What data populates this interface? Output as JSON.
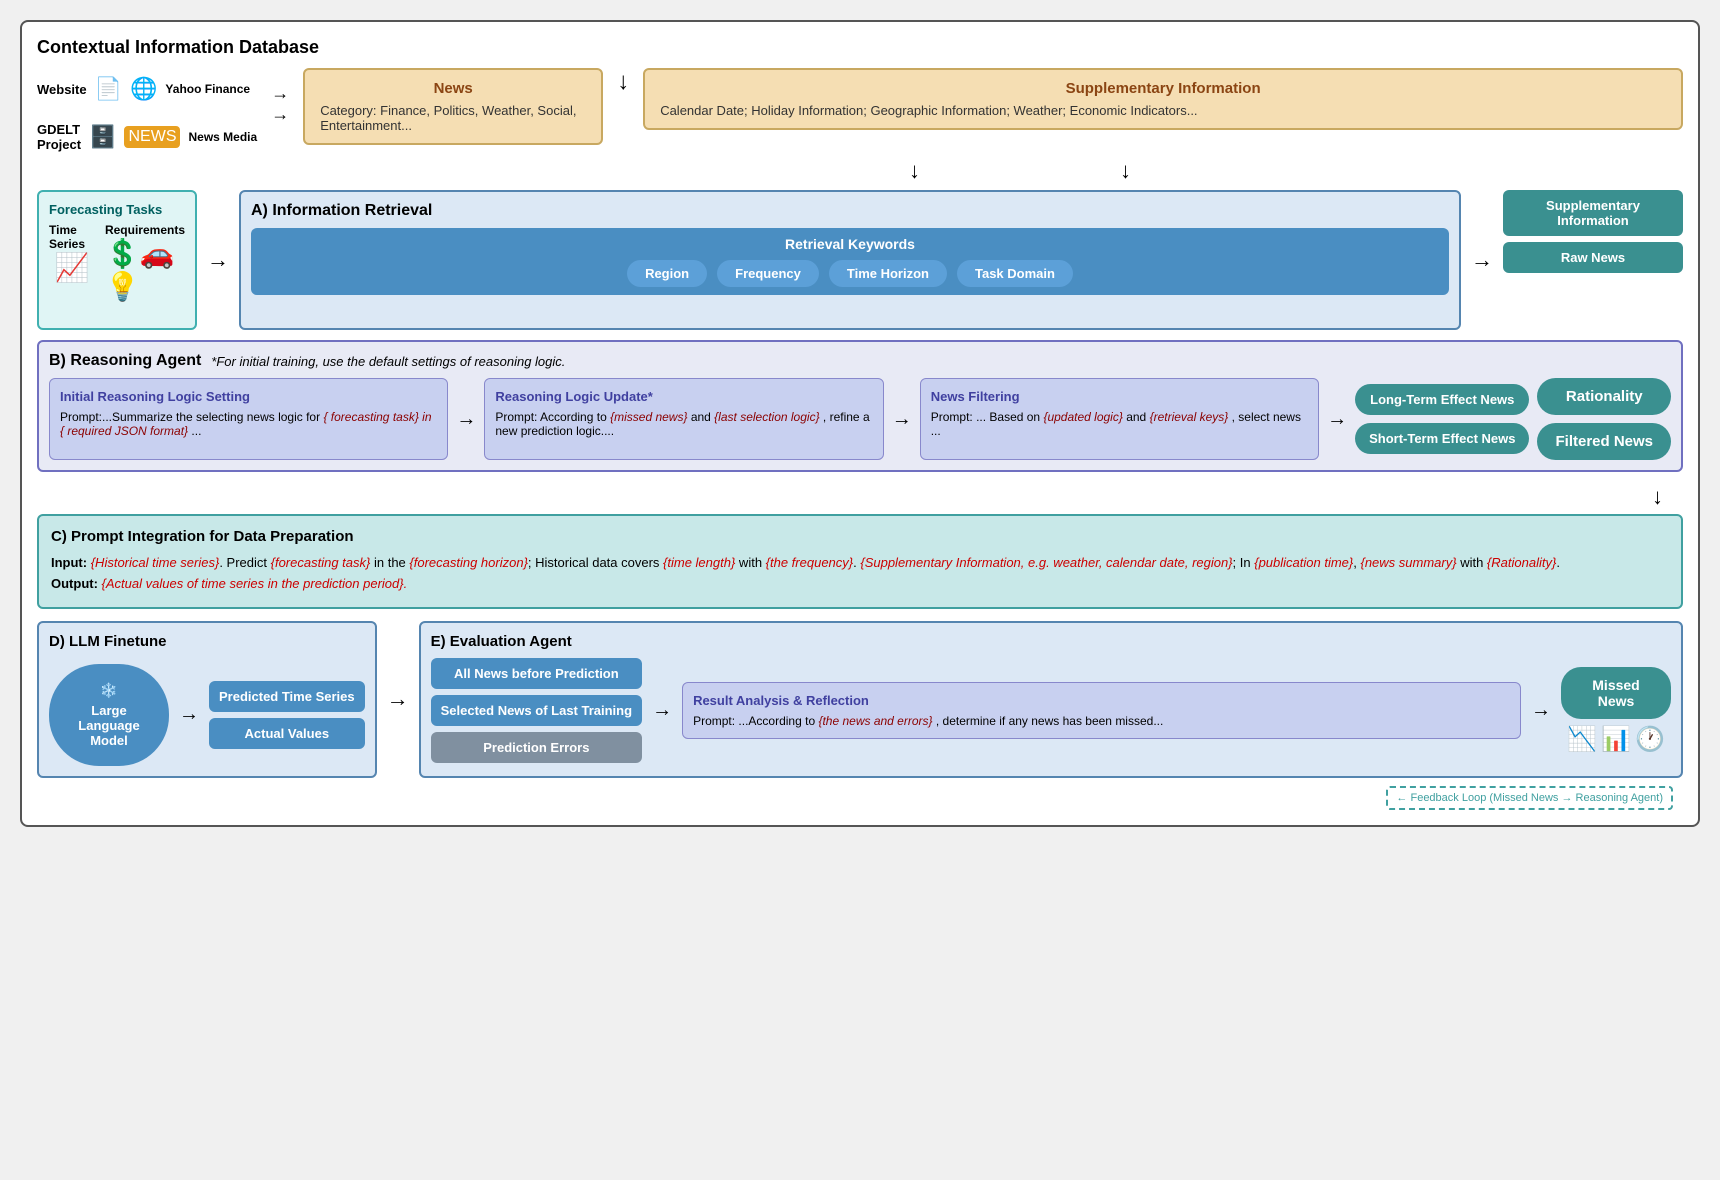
{
  "title": "Contextual Information Database",
  "sources": [
    {
      "label": "Website",
      "icon": "📄",
      "sub": ""
    },
    {
      "label": "GDELT Project",
      "icon": "🗄️",
      "sub": ""
    }
  ],
  "providers": [
    {
      "label": "Yahoo Finance",
      "icon": "🌐"
    },
    {
      "label": "News Media",
      "icon": "📰"
    }
  ],
  "news_box": {
    "title": "News",
    "content": "Category: Finance, Politics, Weather, Social, Entertainment..."
  },
  "supp_box": {
    "title": "Supplementary Information",
    "content": "Calendar Date; Holiday Information; Geographic Information; Weather; Economic Indicators..."
  },
  "section_a": {
    "title": "A) Information Retrieval",
    "forecasting_tasks": {
      "title": "Forecasting Tasks",
      "ts_label": "Time Series",
      "req_label": "Requirements"
    },
    "retrieval_keywords": {
      "label": "Retrieval Keywords",
      "keywords": [
        "Region",
        "Frequency",
        "Time Horizon",
        "Task Domain"
      ]
    },
    "outputs": [
      "Supplementary Information",
      "Raw News"
    ]
  },
  "section_b": {
    "title": "B) Reasoning Agent",
    "note": "*For initial training, use the default settings of reasoning logic.",
    "box1": {
      "title": "Initial Reasoning Logic Setting",
      "text_prefix": "Prompt:...Summarize the selecting news logic for ",
      "highlight": "{ forecasting task} in { required JSON format}",
      "text_suffix": "..."
    },
    "box2": {
      "title": "Reasoning Logic Update*",
      "text_prefix": "Prompt: According to ",
      "highlight1": "{missed news}",
      "text_mid": " and ",
      "highlight2": "{last selection logic}",
      "text_suffix": ", refine a new prediction logic...."
    },
    "box3": {
      "title": "News Filtering",
      "text_prefix": "Prompt: ... Based on ",
      "highlight1": "{updated logic}",
      "text_mid": " and ",
      "highlight2": "{retrieval keys}",
      "text_suffix": ", select news ..."
    },
    "outputs_left": [
      "Long-Term Effect News",
      "Short-Term Effect News"
    ],
    "outputs_right": [
      "Rationality",
      "Filtered News"
    ]
  },
  "section_c": {
    "title": "C) Prompt Integration for Data Preparation",
    "input_label": "Input:",
    "input_text": " {Historical time series}. Predict {forecasting task} in the {forecasting horizon}; Historical data covers {time length} with {the frequency}. {Supplementary Information, e.g. weather, calendar date, region}; In {publication time}, {news summary} with {Rationality}.",
    "output_label": "Output:",
    "output_text": " {Actual values of time series in the prediction period}."
  },
  "section_d": {
    "title": "D) LLM Finetune",
    "llm_label": "Large Language Model",
    "llm_icon": "❄️",
    "outputs": [
      "Predicted Time Series",
      "Actual Values"
    ]
  },
  "section_e": {
    "title": "E) Evaluation Agent",
    "news_items": [
      "All News before Prediction",
      "Selected News of Last Training",
      "Prediction Errors"
    ],
    "result_analysis": {
      "title": "Result Analysis & Reflection",
      "text_prefix": "Prompt: ...According to ",
      "highlight": "{the news and errors}",
      "text_suffix": ", determine if any news has been missed..."
    },
    "missed_news": "Missed News"
  },
  "feedback_label": "feedback loop"
}
